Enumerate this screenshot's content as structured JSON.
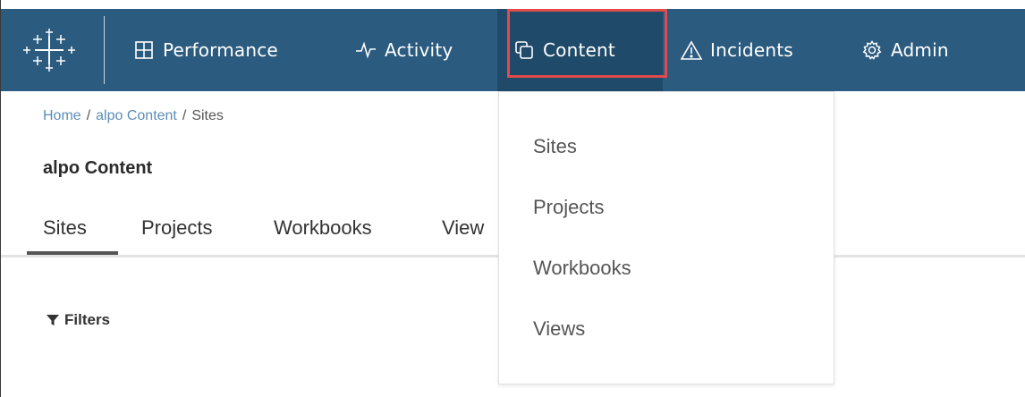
{
  "nav": {
    "items": [
      {
        "label": "Performance",
        "icon": "grid-icon"
      },
      {
        "label": "Activity",
        "icon": "pulse-icon"
      },
      {
        "label": "Content",
        "icon": "copy-icon",
        "active": true
      },
      {
        "label": "Incidents",
        "icon": "warning-triangle-icon"
      },
      {
        "label": "Admin",
        "icon": "gear-icon"
      }
    ]
  },
  "breadcrumb": {
    "home": "Home",
    "section": "alpo Content",
    "current": "Sites",
    "separator": "/"
  },
  "page": {
    "title": "alpo Content"
  },
  "tabs": [
    {
      "label": "Sites",
      "selected": true
    },
    {
      "label": "Projects"
    },
    {
      "label": "Workbooks"
    },
    {
      "label": "View"
    }
  ],
  "filters": {
    "label": "Filters"
  },
  "dropdown": {
    "items": [
      "Sites",
      "Projects",
      "Workbooks",
      "Views"
    ]
  },
  "colors": {
    "topbar": "#2b5b7f",
    "active": "#1f4a69",
    "highlight": "#e14b4b",
    "link": "#5b8db7"
  }
}
